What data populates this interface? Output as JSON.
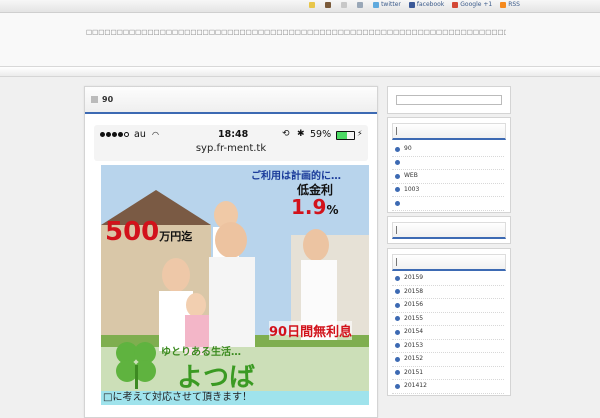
{
  "toplinks": {
    "twitter": "twitter",
    "facebook": "facebook",
    "google": "Google +1",
    "rss": "RSS"
  },
  "header": {
    "tagline": "□□□□□□□□□□□□□□□□□□□□□□□□□□□□□□□□□□□□□□□□□□□□□□□□□□□□□□□□□□□□□□□□□□□□□□"
  },
  "post": {
    "title": "90",
    "phone": {
      "carrier": "au",
      "time": "18:48",
      "battery": "59%",
      "url": "syp.fr-ment.tk"
    },
    "ad": {
      "line1": "ご利用は計画的に…",
      "rate_label": "低金利",
      "rate": "1.9",
      "rate_unit": "%",
      "amount": "500",
      "amount_unit": "万円迄",
      "free_days": "90日間無利息",
      "slogan": "ゆとりある生活…",
      "brand": "よつば"
    },
    "caption": "□に考えて対応させて頂きます！"
  },
  "sidebar": {
    "widget1": {
      "items": [
        "90",
        "",
        "WEB",
        "1003",
        ""
      ]
    },
    "widget3": {
      "items": [
        "20159",
        "20158",
        "20156",
        "20155",
        "20154",
        "20153",
        "20152",
        "20151",
        "201412"
      ]
    }
  },
  "colors": {
    "accent": "#3d6ab3"
  }
}
